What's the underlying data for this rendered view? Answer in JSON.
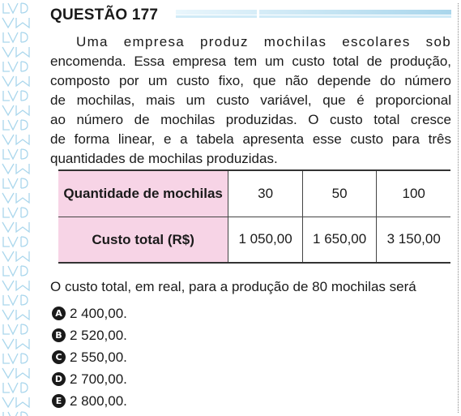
{
  "question": {
    "title": "QUESTÃO 177",
    "paragraph_lines": [
      "Uma empresa produz mochilas escolares sob",
      "encomenda. Essa empresa tem um custo total de produção,",
      "composto por um custo fixo, que não depende do número",
      "de mochilas, mais um custo variável, que é proporcional",
      "ao número de mochilas produzidas. O custo total cresce",
      "de forma linear, e a tabela apresenta esse custo para três",
      "quantidades de mochilas produzidas."
    ],
    "prompt": "O custo total, em real, para a produção de 80 mochilas será"
  },
  "table": {
    "row1_header": "Quantidade de mochilas",
    "row1_values": [
      "30",
      "50",
      "100"
    ],
    "row2_header": "Custo total (R$)",
    "row2_values": [
      "1 050,00",
      "1 650,00",
      "3 150,00"
    ]
  },
  "options": [
    {
      "letter": "A",
      "text": "2 400,00."
    },
    {
      "letter": "B",
      "text": "2 520,00."
    },
    {
      "letter": "C",
      "text": "2 550,00."
    },
    {
      "letter": "D",
      "text": "2 700,00."
    },
    {
      "letter": "E",
      "text": "2 800,00."
    }
  ],
  "colors": {
    "table_header_bg": "#f7d4e6",
    "title_bar": "#bfe3f5",
    "watermark": "#a9d6ec"
  }
}
